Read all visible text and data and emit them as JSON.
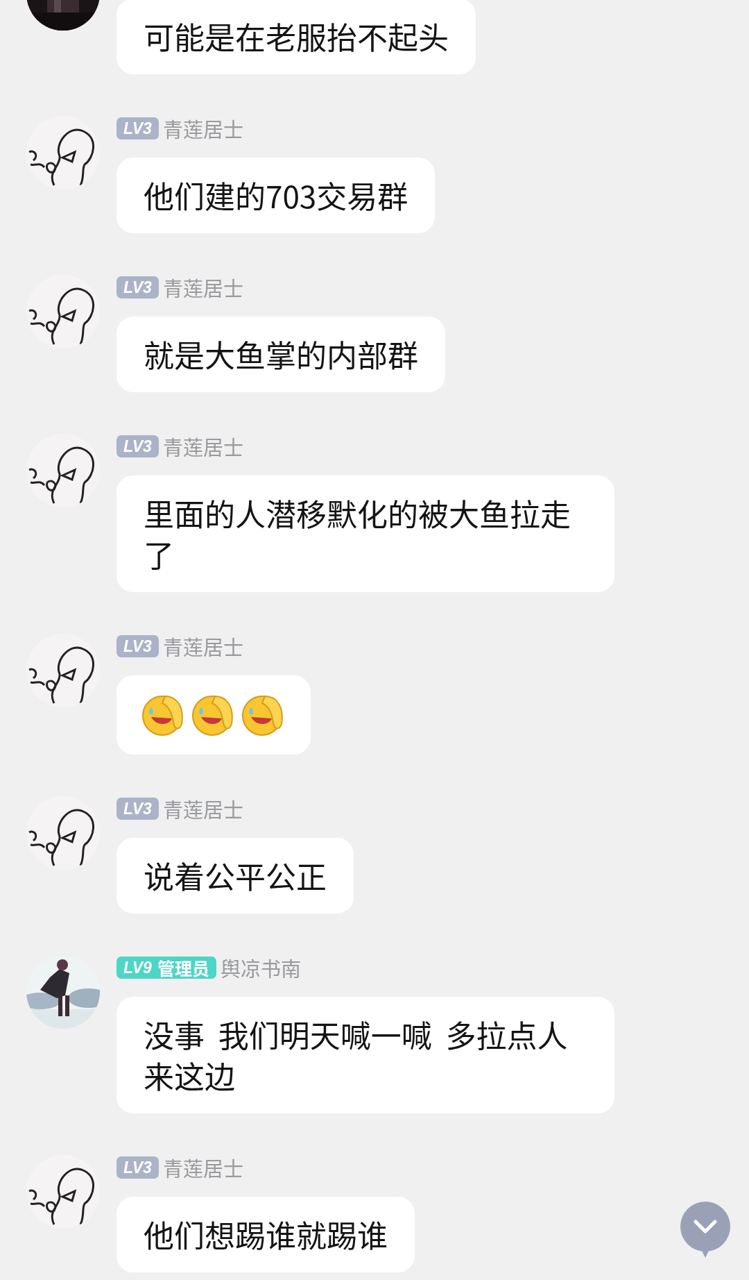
{
  "messages": [
    {
      "avatar": {
        "kind": "dark"
      },
      "text": "可能是在老服抬不起头"
    },
    {
      "avatar": {
        "kind": "sketch"
      },
      "badge": {
        "level": "LV3",
        "color": "#aab3c7"
      },
      "sender": "青莲居士",
      "text": "他们建的703交易群"
    },
    {
      "avatar": {
        "kind": "sketch"
      },
      "badge": {
        "level": "LV3",
        "color": "#aab3c7"
      },
      "sender": "青莲居士",
      "text": "就是大鱼掌的内部群"
    },
    {
      "avatar": {
        "kind": "sketch"
      },
      "badge": {
        "level": "LV3",
        "color": "#aab3c7"
      },
      "sender": "青莲居士",
      "text": "里面的人潜移默化的被大鱼拉走了"
    },
    {
      "avatar": {
        "kind": "sketch"
      },
      "badge": {
        "level": "LV3",
        "color": "#aab3c7"
      },
      "sender": "青莲居士",
      "emojis": [
        {
          "kind": "icon"
        },
        {
          "kind": "icon"
        },
        {
          "kind": "icon"
        }
      ]
    },
    {
      "avatar": {
        "kind": "sketch"
      },
      "badge": {
        "level": "LV3",
        "color": "#aab3c7"
      },
      "sender": "青莲居士",
      "text": "说着公平公正"
    },
    {
      "badge": {
        "level": "LV9",
        "role": "管理员",
        "color": "#4dd5c6"
      },
      "sender": "舆凉书南",
      "text": "没事  我们明天喊一喊  多拉点人来这边"
    },
    {
      "avatar": {
        "kind": "sketch"
      },
      "badge": {
        "level": "LV3",
        "color": "#aab3c7"
      },
      "sender": "青莲居士",
      "text": "他们想踢谁就踢谁"
    }
  ],
  "scroll_button": {
    "kind": "down"
  }
}
